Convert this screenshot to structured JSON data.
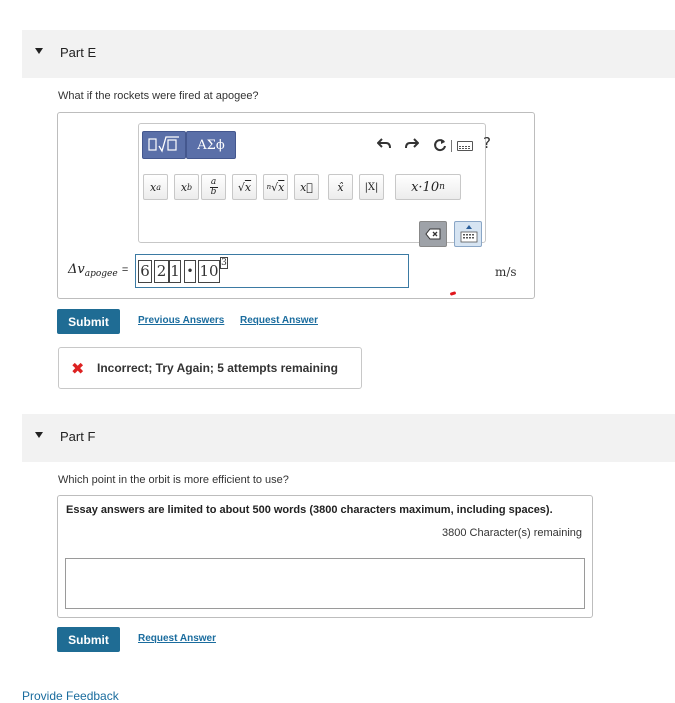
{
  "part_e": {
    "title": "Part E",
    "question": "What if the rockets were fired at apogee?",
    "toolbar": {
      "template_button_icon": "radical-template-icon",
      "greek_button_label": "ΑΣϕ",
      "icons": [
        "undo-icon",
        "redo-icon",
        "reset-icon",
        "keyboard-shortcuts-icon",
        "help-icon"
      ],
      "help_label": "?",
      "math_buttons": [
        "xᵃ",
        "x_b",
        "a/b",
        "√x",
        "ⁿ√x",
        "x⃗",
        "x̂",
        "|X|",
        "x·10ⁿ"
      ]
    },
    "variable": {
      "symbol": "Δv",
      "subscript": "apogee",
      "equals": "="
    },
    "answer": {
      "mantissa_digits": [
        "6",
        "2",
        "1"
      ],
      "times": "•",
      "base": "10",
      "exponent": "3"
    },
    "units": "m/s",
    "submit_label": "Submit",
    "previous_answers_label": "Previous Answers",
    "request_answer_label": "Request Answer",
    "feedback": {
      "icon": "x-icon",
      "message": "Incorrect; Try Again; 5 attempts remaining"
    }
  },
  "part_f": {
    "title": "Part F",
    "question": "Which point in the orbit is more efficient to use?",
    "essay_note": "Essay answers are limited to about 500 words (3800 characters maximum, including spaces).",
    "characters_remaining": "3800 Character(s) remaining",
    "essay_value": "",
    "submit_label": "Submit",
    "request_answer_label": "Request Answer"
  },
  "footer": {
    "provide_feedback_label": "Provide Feedback"
  },
  "colors": {
    "submit": "#1f6c94",
    "link": "#1a6c9e",
    "toolbar_active": "#5a6fa8",
    "error": "#dd2222"
  }
}
